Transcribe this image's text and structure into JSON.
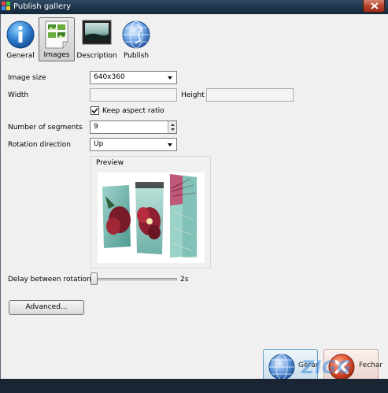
{
  "window": {
    "title": "Publish gallery"
  },
  "toolbar": {
    "items": [
      {
        "label": "General",
        "icon": "info-icon"
      },
      {
        "label": "Images",
        "icon": "images-icon",
        "active": true
      },
      {
        "label": "Description",
        "icon": "description-icon"
      },
      {
        "label": "Publish",
        "icon": "globe-icon"
      }
    ]
  },
  "form": {
    "image_size": {
      "label": "Image size",
      "value": "640x360"
    },
    "width": {
      "label": "Width",
      "value": ""
    },
    "height": {
      "label": "Height",
      "value": ""
    },
    "keep_aspect": {
      "label": "Keep aspect ratio",
      "checked": true
    },
    "segments": {
      "label": "Number of segments",
      "value": "9"
    },
    "rotation": {
      "label": "Rotation direction",
      "value": "Up"
    },
    "preview": {
      "label": "Preview"
    },
    "delay": {
      "label": "Delay between rotations",
      "value_text": "2s",
      "value_seconds": 2
    },
    "advanced_label": "Advanced..."
  },
  "actions": {
    "gerar_label": "Gerar",
    "fechar_label": "Fechar"
  },
  "watermark": {
    "text": "ZIGG"
  },
  "colors": {
    "title_bar": "#1d3348",
    "client_bg": "#f0f0f0",
    "accent_blue": "#2f7fd0",
    "close_red": "#b4412a"
  }
}
